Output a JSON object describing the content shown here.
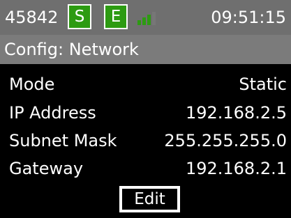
{
  "status_bar": {
    "device_id": "45842",
    "badge_s": "S",
    "badge_e": "E",
    "signal_icon": "signal-strength-icon",
    "time": "09:51:15",
    "colors": {
      "bar": "#6f6f6f",
      "badge": "#2d9b12",
      "signal_active": "#2d9b12",
      "signal_inactive": "#777777"
    }
  },
  "header": {
    "title": "Config: Network"
  },
  "settings": [
    {
      "label": "Mode",
      "value": "Static"
    },
    {
      "label": "IP Address",
      "value": "192.168.2.5"
    },
    {
      "label": "Subnet Mask",
      "value": "255.255.255.0"
    },
    {
      "label": "Gateway",
      "value": "192.168.2.1"
    }
  ],
  "actions": {
    "edit_label": "Edit"
  }
}
